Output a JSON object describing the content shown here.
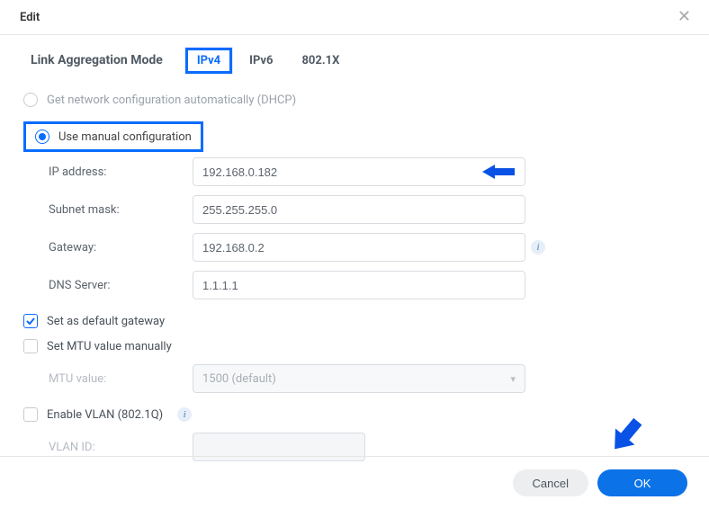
{
  "dialog": {
    "title": "Edit"
  },
  "tabs": {
    "link_aggregation": "Link Aggregation Mode",
    "ipv4": "IPv4",
    "ipv6": "IPv6",
    "dot1x": "802.1X"
  },
  "radios": {
    "dhcp": "Get network configuration automatically (DHCP)",
    "manual": "Use manual configuration"
  },
  "fields": {
    "ip_label": "IP address:",
    "ip_value": "192.168.0.182",
    "subnet_label": "Subnet mask:",
    "subnet_value": "255.255.255.0",
    "gateway_label": "Gateway:",
    "gateway_value": "192.168.0.2",
    "dns_label": "DNS Server:",
    "dns_value": "1.1.1.1",
    "mtu_label": "MTU value:",
    "mtu_value": "1500 (default)",
    "vlan_label": "VLAN ID:",
    "vlan_value": ""
  },
  "checks": {
    "default_gw": "Set as default gateway",
    "mtu_manual": "Set MTU value manually",
    "enable_vlan": "Enable VLAN (802.1Q)"
  },
  "footer": {
    "cancel": "Cancel",
    "ok": "OK"
  }
}
